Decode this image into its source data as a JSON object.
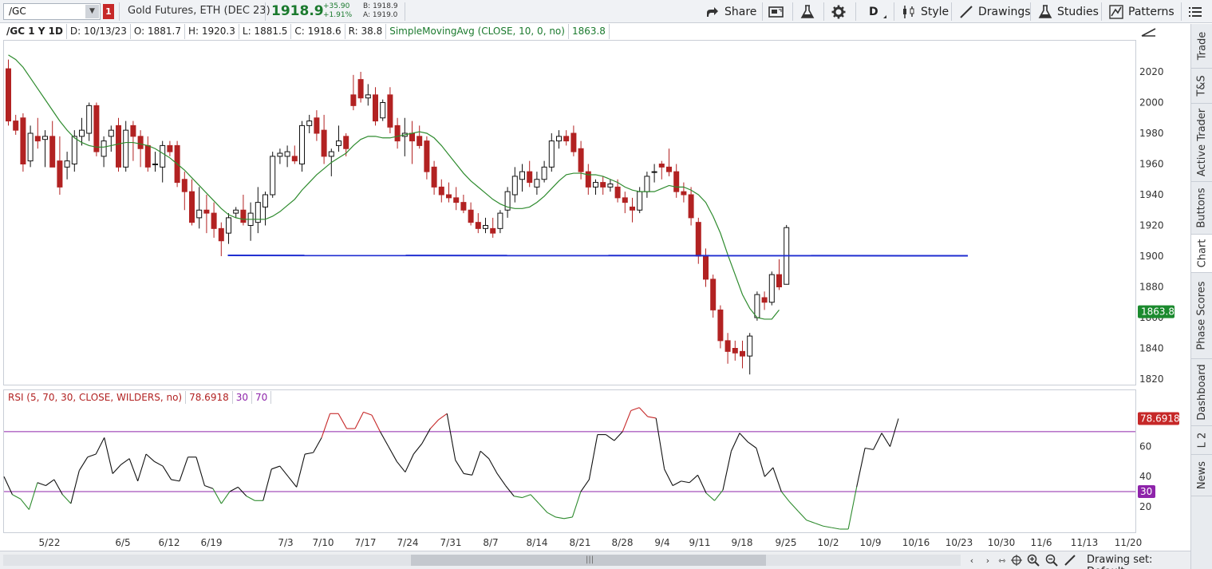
{
  "toolbar": {
    "symbol": "/GC",
    "link_badge": "1",
    "description": "Gold Futures, ETH (DEC 23)",
    "last_price": "1918.9",
    "net_change": "+35.90",
    "pct_change": "+1.91%",
    "bid": "B: 1918.9",
    "ask": "A: 1919.0",
    "share_label": "Share",
    "aggregation_label": "D",
    "style_label": "Style",
    "drawings_label": "Drawings",
    "studies_label": "Studies",
    "patterns_label": "Patterns"
  },
  "header": {
    "symbol_period": "/GC 1 Y 1D",
    "date": "D: 10/13/23",
    "open": "O: 1881.7",
    "high": "H: 1920.3",
    "low": "L: 1881.5",
    "close": "C: 1918.6",
    "range": "R: 38.8",
    "study": "SimpleMovingAvg (CLOSE, 10, 0, no)",
    "study_value": "1863.8"
  },
  "rsi": {
    "label": "RSI (5, 70, 30, CLOSE, WILDERS, no)",
    "value": "78.6918",
    "low_level": "30",
    "high_level": "70",
    "y_ticks": [
      "20",
      "40",
      "60"
    ],
    "overbought_color": "#c62828",
    "oversold_color": "#2e8b2e",
    "neutral_color": "#111111",
    "level_color": "#8e24aa"
  },
  "price_axis": {
    "ticks": [
      "1820",
      "1840",
      "1860",
      "1880",
      "1900",
      "1920",
      "1940",
      "1960",
      "1980",
      "2000",
      "2020"
    ],
    "sma_badge": "1863.8",
    "badge_color": "#1b8a2e"
  },
  "time_axis": {
    "labels": [
      "5/22",
      "6/5",
      "6/12",
      "6/19",
      "7/3",
      "7/10",
      "7/17",
      "7/24",
      "7/31",
      "8/7",
      "8/14",
      "8/21",
      "8/28",
      "9/4",
      "9/11",
      "9/18",
      "9/25",
      "10/2",
      "10/9",
      "10/16",
      "10/23",
      "10/30",
      "11/6",
      "11/13",
      "11/20"
    ]
  },
  "chart_data": {
    "type": "candlestick",
    "x_label_dates": [
      "5/22",
      "6/5",
      "6/12",
      "6/19",
      "7/3",
      "7/10",
      "7/17",
      "7/24",
      "7/31",
      "8/7",
      "8/14",
      "8/21",
      "8/28",
      "9/4",
      "9/11",
      "9/18",
      "9/25",
      "10/2",
      "10/9",
      "10/16",
      "10/23",
      "10/30",
      "11/6",
      "11/13",
      "11/20"
    ],
    "ylim": [
      1812,
      2035
    ],
    "up_color": "#111111",
    "down_color": "#b22222",
    "candles": [
      {
        "o": 2022,
        "h": 2028,
        "l": 1985,
        "c": 1988
      },
      {
        "o": 1988,
        "h": 1992,
        "l": 1979,
        "c": 1982
      },
      {
        "o": 1990,
        "h": 1993,
        "l": 1955,
        "c": 1960
      },
      {
        "o": 1962,
        "h": 1985,
        "l": 1958,
        "c": 1980
      },
      {
        "o": 1978,
        "h": 1990,
        "l": 1970,
        "c": 1975
      },
      {
        "o": 1976,
        "h": 1982,
        "l": 1958,
        "c": 1978
      },
      {
        "o": 1978,
        "h": 1988,
        "l": 1958,
        "c": 1958
      },
      {
        "o": 1962,
        "h": 1978,
        "l": 1940,
        "c": 1945
      },
      {
        "o": 1958,
        "h": 1968,
        "l": 1950,
        "c": 1962
      },
      {
        "o": 1960,
        "h": 1982,
        "l": 1955,
        "c": 1978
      },
      {
        "o": 1978,
        "h": 1990,
        "l": 1972,
        "c": 1982
      },
      {
        "o": 1980,
        "h": 2000,
        "l": 1975,
        "c": 1998
      },
      {
        "o": 1998,
        "h": 2000,
        "l": 1965,
        "c": 1968
      },
      {
        "o": 1965,
        "h": 1978,
        "l": 1958,
        "c": 1975
      },
      {
        "o": 1978,
        "h": 1985,
        "l": 1968,
        "c": 1982
      },
      {
        "o": 1985,
        "h": 1990,
        "l": 1955,
        "c": 1958
      },
      {
        "o": 1958,
        "h": 1988,
        "l": 1955,
        "c": 1982
      },
      {
        "o": 1985,
        "h": 1988,
        "l": 1962,
        "c": 1978
      },
      {
        "o": 1978,
        "h": 1982,
        "l": 1958,
        "c": 1970
      },
      {
        "o": 1972,
        "h": 1978,
        "l": 1955,
        "c": 1958
      },
      {
        "o": 1960,
        "h": 1968,
        "l": 1955,
        "c": 1960
      },
      {
        "o": 1958,
        "h": 1975,
        "l": 1948,
        "c": 1972
      },
      {
        "o": 1972,
        "h": 1975,
        "l": 1965,
        "c": 1968
      },
      {
        "o": 1972,
        "h": 1975,
        "l": 1945,
        "c": 1948
      },
      {
        "o": 1950,
        "h": 1955,
        "l": 1930,
        "c": 1942
      },
      {
        "o": 1942,
        "h": 1950,
        "l": 1920,
        "c": 1922
      },
      {
        "o": 1925,
        "h": 1945,
        "l": 1918,
        "c": 1930
      },
      {
        "o": 1930,
        "h": 1940,
        "l": 1915,
        "c": 1928
      },
      {
        "o": 1928,
        "h": 1935,
        "l": 1912,
        "c": 1918
      },
      {
        "o": 1918,
        "h": 1922,
        "l": 1900,
        "c": 1910
      },
      {
        "o": 1915,
        "h": 1928,
        "l": 1908,
        "c": 1925
      },
      {
        "o": 1928,
        "h": 1932,
        "l": 1925,
        "c": 1930
      },
      {
        "o": 1930,
        "h": 1940,
        "l": 1920,
        "c": 1922
      },
      {
        "o": 1920,
        "h": 1935,
        "l": 1910,
        "c": 1928
      },
      {
        "o": 1922,
        "h": 1945,
        "l": 1915,
        "c": 1935
      },
      {
        "o": 1932,
        "h": 1942,
        "l": 1920,
        "c": 1940
      },
      {
        "o": 1940,
        "h": 1968,
        "l": 1938,
        "c": 1965
      },
      {
        "o": 1965,
        "h": 1970,
        "l": 1960,
        "c": 1967
      },
      {
        "o": 1965,
        "h": 1972,
        "l": 1958,
        "c": 1968
      },
      {
        "o": 1965,
        "h": 1972,
        "l": 1960,
        "c": 1962
      },
      {
        "o": 1960,
        "h": 1988,
        "l": 1955,
        "c": 1985
      },
      {
        "o": 1985,
        "h": 1992,
        "l": 1980,
        "c": 1988
      },
      {
        "o": 1990,
        "h": 1995,
        "l": 1975,
        "c": 1980
      },
      {
        "o": 1982,
        "h": 1992,
        "l": 1960,
        "c": 1965
      },
      {
        "o": 1965,
        "h": 1970,
        "l": 1952,
        "c": 1968
      },
      {
        "o": 1972,
        "h": 1985,
        "l": 1968,
        "c": 1975
      },
      {
        "o": 1978,
        "h": 1980,
        "l": 1965,
        "c": 1970
      },
      {
        "o": 2005,
        "h": 2018,
        "l": 1995,
        "c": 1998
      },
      {
        "o": 2015,
        "h": 2020,
        "l": 2000,
        "c": 2003
      },
      {
        "o": 2003,
        "h": 2012,
        "l": 1998,
        "c": 2005
      },
      {
        "o": 2005,
        "h": 2010,
        "l": 1985,
        "c": 1988
      },
      {
        "o": 1990,
        "h": 2002,
        "l": 1988,
        "c": 2000
      },
      {
        "o": 2005,
        "h": 2010,
        "l": 1980,
        "c": 1984
      },
      {
        "o": 1985,
        "h": 1990,
        "l": 1970,
        "c": 1975
      },
      {
        "o": 1978,
        "h": 1990,
        "l": 1965,
        "c": 1980
      },
      {
        "o": 1980,
        "h": 1988,
        "l": 1960,
        "c": 1975
      },
      {
        "o": 1978,
        "h": 1985,
        "l": 1970,
        "c": 1972
      },
      {
        "o": 1975,
        "h": 1978,
        "l": 1950,
        "c": 1955
      },
      {
        "o": 1958,
        "h": 1962,
        "l": 1940,
        "c": 1945
      },
      {
        "o": 1945,
        "h": 1950,
        "l": 1935,
        "c": 1940
      },
      {
        "o": 1940,
        "h": 1948,
        "l": 1935,
        "c": 1938
      },
      {
        "o": 1938,
        "h": 1945,
        "l": 1930,
        "c": 1935
      },
      {
        "o": 1935,
        "h": 1940,
        "l": 1928,
        "c": 1930
      },
      {
        "o": 1930,
        "h": 1935,
        "l": 1920,
        "c": 1922
      },
      {
        "o": 1922,
        "h": 1928,
        "l": 1915,
        "c": 1918
      },
      {
        "o": 1918,
        "h": 1925,
        "l": 1915,
        "c": 1920
      },
      {
        "o": 1918,
        "h": 1925,
        "l": 1912,
        "c": 1915
      },
      {
        "o": 1918,
        "h": 1930,
        "l": 1915,
        "c": 1928
      },
      {
        "o": 1930,
        "h": 1945,
        "l": 1925,
        "c": 1942
      },
      {
        "o": 1940,
        "h": 1958,
        "l": 1935,
        "c": 1952
      },
      {
        "o": 1950,
        "h": 1960,
        "l": 1942,
        "c": 1955
      },
      {
        "o": 1955,
        "h": 1962,
        "l": 1945,
        "c": 1948
      },
      {
        "o": 1945,
        "h": 1955,
        "l": 1940,
        "c": 1950
      },
      {
        "o": 1950,
        "h": 1962,
        "l": 1948,
        "c": 1958
      },
      {
        "o": 1958,
        "h": 1980,
        "l": 1955,
        "c": 1975
      },
      {
        "o": 1975,
        "h": 1982,
        "l": 1970,
        "c": 1978
      },
      {
        "o": 1978,
        "h": 1982,
        "l": 1972,
        "c": 1975
      },
      {
        "o": 1980,
        "h": 1985,
        "l": 1965,
        "c": 1968
      },
      {
        "o": 1970,
        "h": 1975,
        "l": 1950,
        "c": 1955
      },
      {
        "o": 1955,
        "h": 1960,
        "l": 1940,
        "c": 1945
      },
      {
        "o": 1945,
        "h": 1950,
        "l": 1940,
        "c": 1948
      },
      {
        "o": 1948,
        "h": 1952,
        "l": 1940,
        "c": 1945
      },
      {
        "o": 1945,
        "h": 1950,
        "l": 1942,
        "c": 1947
      },
      {
        "o": 1945,
        "h": 1950,
        "l": 1935,
        "c": 1938
      },
      {
        "o": 1938,
        "h": 1942,
        "l": 1928,
        "c": 1935
      },
      {
        "o": 1932,
        "h": 1938,
        "l": 1922,
        "c": 1930
      },
      {
        "o": 1930,
        "h": 1945,
        "l": 1928,
        "c": 1942
      },
      {
        "o": 1942,
        "h": 1955,
        "l": 1938,
        "c": 1952
      },
      {
        "o": 1955,
        "h": 1960,
        "l": 1948,
        "c": 1955
      },
      {
        "o": 1960,
        "h": 1962,
        "l": 1950,
        "c": 1958
      },
      {
        "o": 1958,
        "h": 1970,
        "l": 1952,
        "c": 1955
      },
      {
        "o": 1955,
        "h": 1960,
        "l": 1938,
        "c": 1942
      },
      {
        "o": 1942,
        "h": 1948,
        "l": 1935,
        "c": 1940
      },
      {
        "o": 1940,
        "h": 1945,
        "l": 1920,
        "c": 1925
      },
      {
        "o": 1922,
        "h": 1925,
        "l": 1895,
        "c": 1900
      },
      {
        "o": 1900,
        "h": 1905,
        "l": 1880,
        "c": 1885
      },
      {
        "o": 1885,
        "h": 1888,
        "l": 1860,
        "c": 1865
      },
      {
        "o": 1865,
        "h": 1868,
        "l": 1840,
        "c": 1845
      },
      {
        "o": 1845,
        "h": 1850,
        "l": 1830,
        "c": 1838
      },
      {
        "o": 1840,
        "h": 1845,
        "l": 1832,
        "c": 1837
      },
      {
        "o": 1838,
        "h": 1845,
        "l": 1827,
        "c": 1835
      },
      {
        "o": 1835,
        "h": 1850,
        "l": 1823,
        "c": 1848
      },
      {
        "o": 1860,
        "h": 1877,
        "l": 1858,
        "c": 1875
      },
      {
        "o": 1873,
        "h": 1877,
        "l": 1865,
        "c": 1870
      },
      {
        "o": 1870,
        "h": 1890,
        "l": 1868,
        "c": 1888
      },
      {
        "o": 1888,
        "h": 1898,
        "l": 1878,
        "c": 1880
      },
      {
        "o": 1881.7,
        "h": 1920.3,
        "l": 1881.5,
        "c": 1918.6
      }
    ],
    "sma": [
      2031,
      2028,
      2023,
      2016,
      2009,
      2002,
      1995,
      1988,
      1982,
      1977,
      1974,
      1972,
      1971,
      1971,
      1972,
      1973,
      1974,
      1974,
      1973,
      1972,
      1970,
      1967,
      1964,
      1960,
      1956,
      1951,
      1946,
      1941,
      1936,
      1931,
      1927,
      1925,
      1924,
      1924,
      1924,
      1924,
      1926,
      1929,
      1933,
      1937,
      1943,
      1948,
      1953,
      1957,
      1961,
      1964,
      1967,
      1972,
      1976,
      1978,
      1978,
      1977,
      1977,
      1978,
      1979,
      1980,
      1981,
      1980,
      1977,
      1972,
      1966,
      1960,
      1954,
      1949,
      1945,
      1941,
      1937,
      1934,
      1932,
      1931,
      1931,
      1932,
      1935,
      1939,
      1944,
      1949,
      1953,
      1954,
      1954,
      1953,
      1953,
      1952,
      1950,
      1948,
      1945,
      1943,
      1942,
      1942,
      1942,
      1944,
      1946,
      1945,
      1945,
      1943,
      1940,
      1935,
      1926,
      1915,
      1901,
      1888,
      1875,
      1866,
      1860,
      1859,
      1859,
      1865
    ],
    "support_line": {
      "value": 1900.5,
      "start_index": 30,
      "end_x_label": "11/6"
    },
    "rsi": [
      40,
      28,
      25,
      18,
      36,
      34,
      38,
      28,
      22,
      44,
      53,
      55,
      66,
      42,
      48,
      52,
      37,
      55,
      50,
      47,
      38,
      37,
      53,
      53,
      34,
      32,
      22,
      30,
      33,
      27,
      24,
      24,
      45,
      47,
      40,
      33,
      55,
      56,
      66,
      82,
      82,
      72,
      72,
      83,
      81,
      70,
      60,
      50,
      43,
      55,
      62,
      72,
      78,
      82,
      51,
      42,
      41,
      57,
      52,
      42,
      34,
      27,
      26,
      28,
      22,
      16,
      13,
      12,
      13,
      30,
      38,
      68,
      68,
      64,
      70,
      84,
      86,
      80,
      79,
      45,
      34,
      37,
      36,
      41,
      29,
      24,
      31,
      57,
      69,
      63,
      59,
      40,
      46,
      30,
      23,
      17,
      11,
      9,
      7,
      6,
      5,
      5,
      33,
      59,
      58,
      69,
      60,
      78.7
    ]
  }
}
